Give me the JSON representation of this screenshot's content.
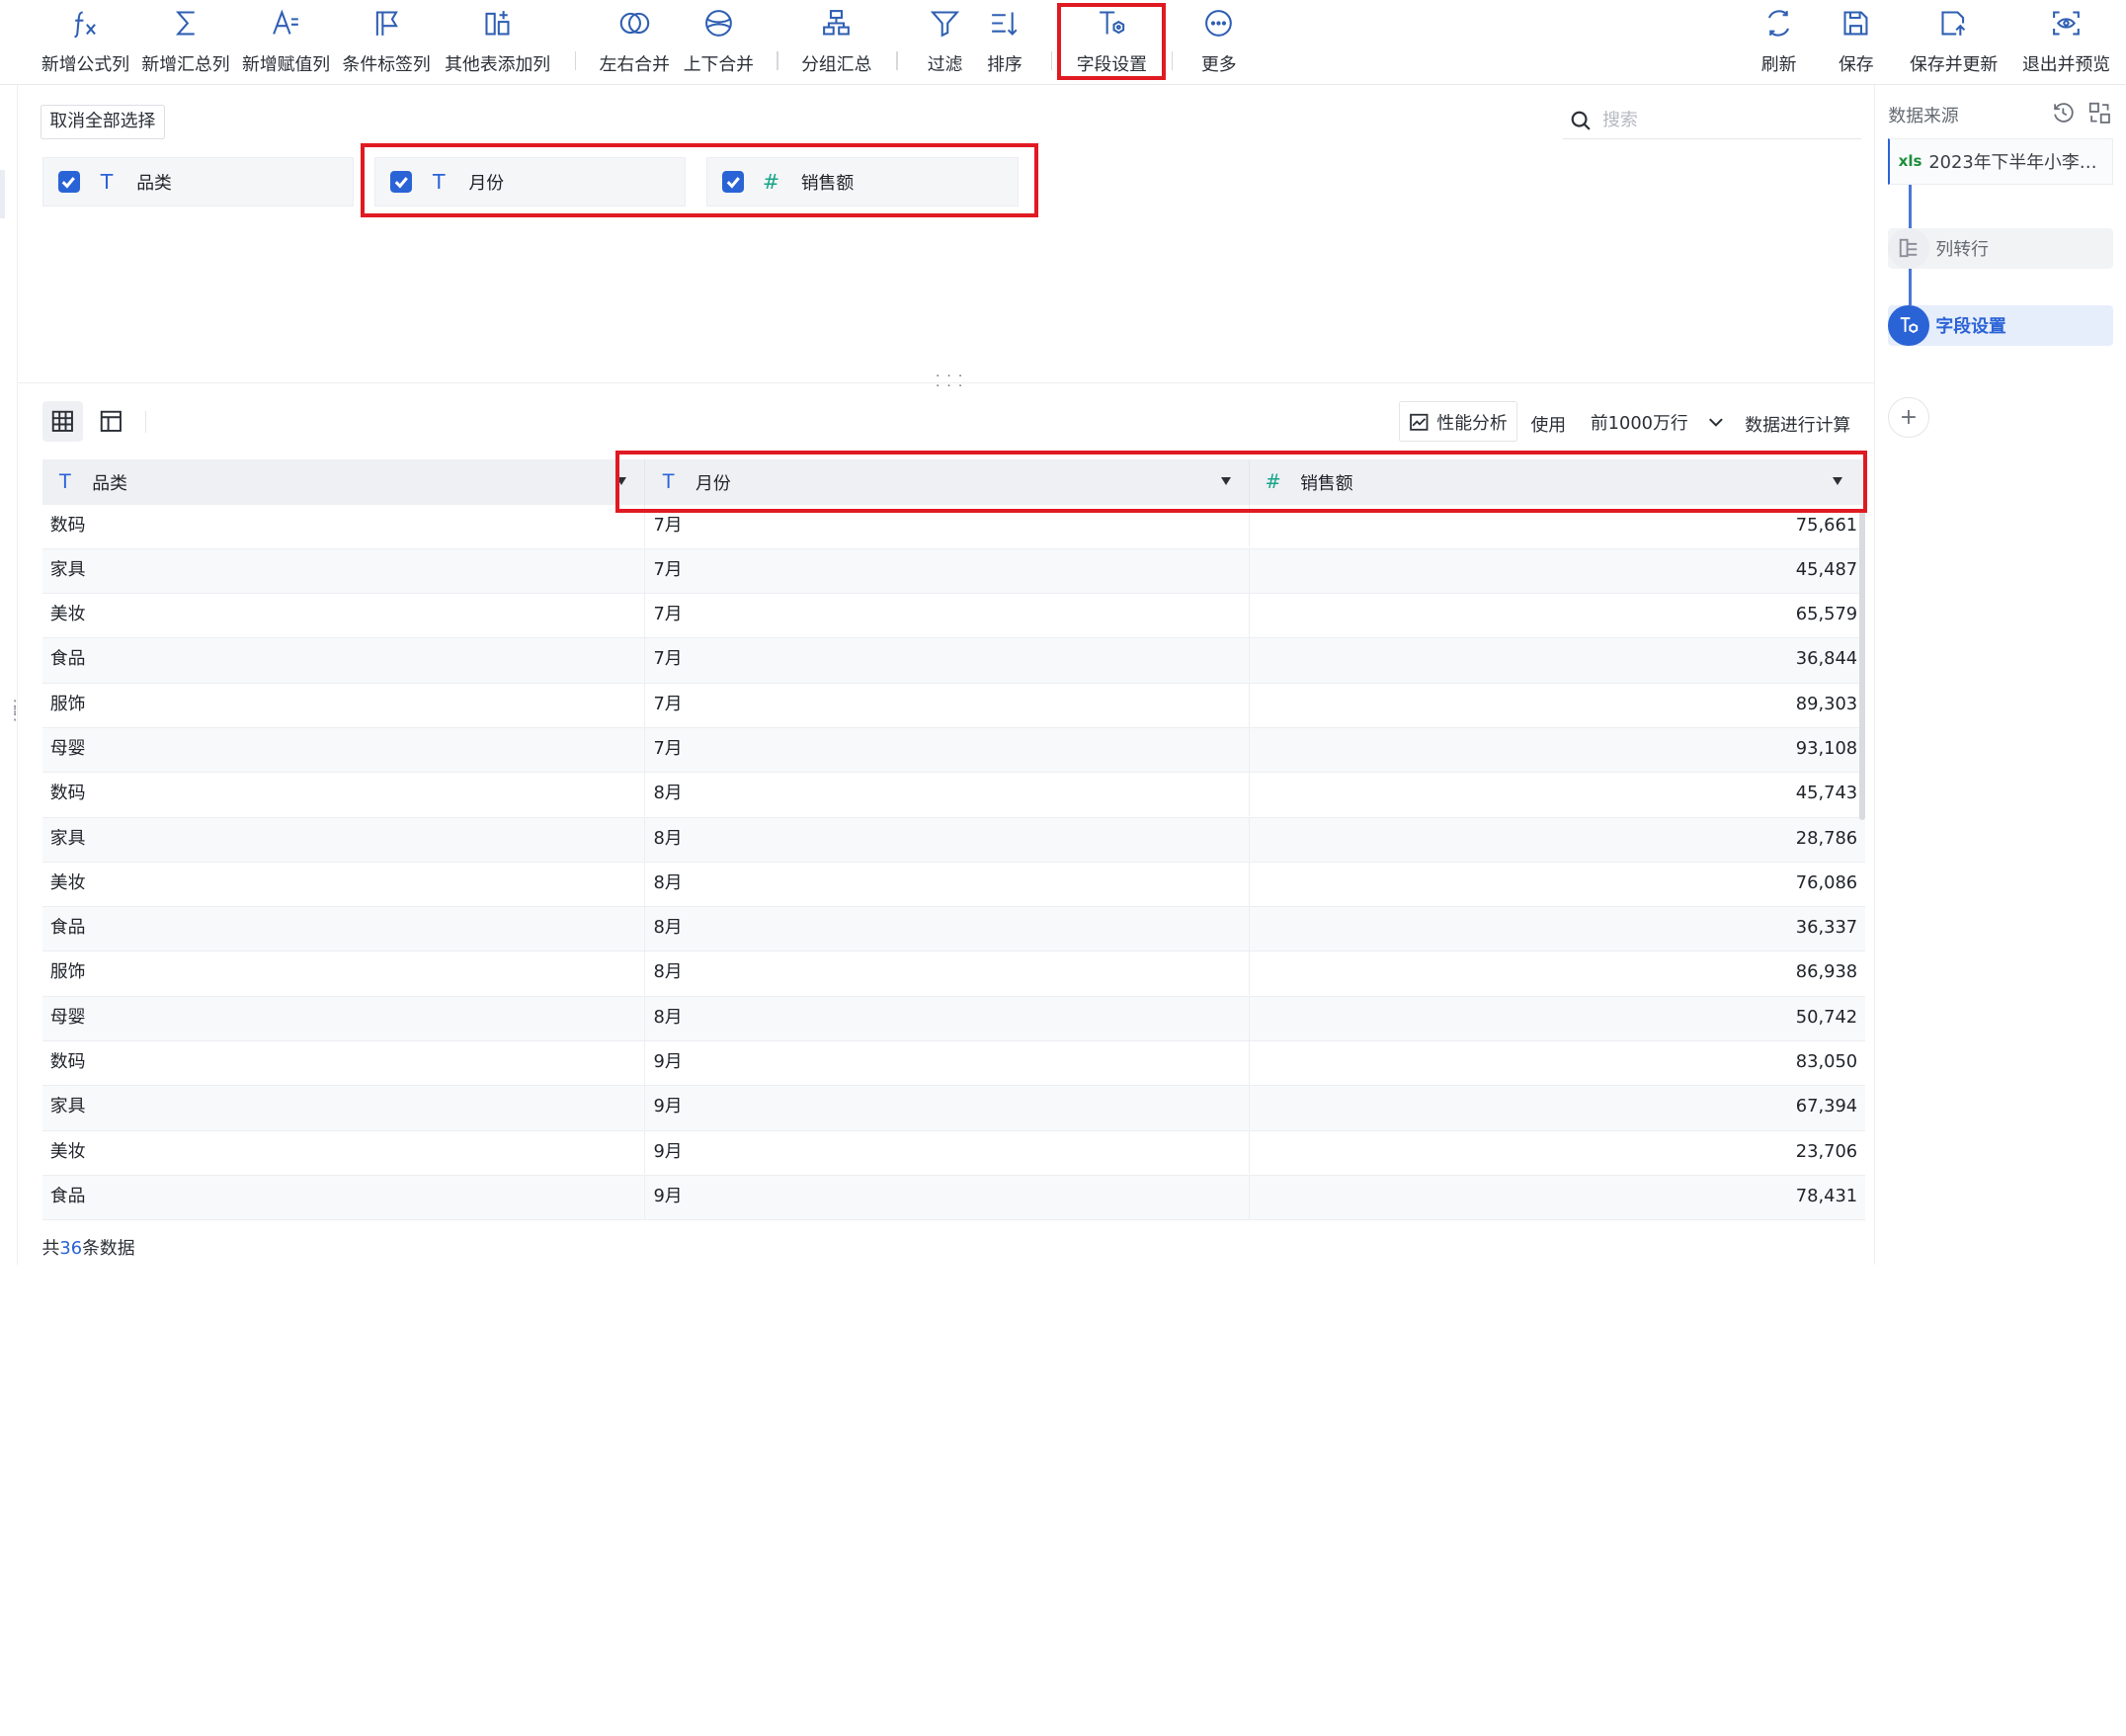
{
  "toolbar": {
    "items": [
      {
        "label": "新增公式列",
        "icon": "formula-icon"
      },
      {
        "label": "新增汇总列",
        "icon": "sigma-icon"
      },
      {
        "label": "新增赋值列",
        "icon": "assign-value-icon"
      },
      {
        "label": "条件标签列",
        "icon": "condition-tag-icon"
      },
      {
        "label": "其他表添加列",
        "icon": "add-column-from-table-icon"
      },
      {
        "label": "左右合并",
        "icon": "join-horizontal-icon"
      },
      {
        "label": "上下合并",
        "icon": "union-vertical-icon"
      },
      {
        "label": "分组汇总",
        "icon": "group-summary-icon"
      },
      {
        "label": "过滤",
        "icon": "filter-icon"
      },
      {
        "label": "排序",
        "icon": "sort-icon"
      },
      {
        "label": "字段设置",
        "icon": "field-settings-icon"
      },
      {
        "label": "更多",
        "icon": "more-icon"
      }
    ],
    "right": [
      {
        "label": "刷新",
        "icon": "refresh-icon"
      },
      {
        "label": "保存",
        "icon": "save-icon"
      },
      {
        "label": "保存并更新",
        "icon": "save-update-icon"
      },
      {
        "label": "退出并预览",
        "icon": "exit-preview-icon"
      }
    ]
  },
  "field_panel": {
    "deselect_all": "取消全部选择",
    "search_placeholder": "搜索",
    "fields": [
      {
        "name": "品类",
        "type_glyph": "T",
        "checked": true
      },
      {
        "name": "月份",
        "type_glyph": "T",
        "checked": true
      },
      {
        "name": "销售额",
        "type_glyph": "#",
        "checked": true
      }
    ]
  },
  "preview": {
    "perf_label": "性能分析",
    "use_label": "使用",
    "rows_option": "前1000万行",
    "calc_label": "数据进行计算",
    "columns": [
      {
        "name": "品类",
        "type_glyph": "T"
      },
      {
        "name": "月份",
        "type_glyph": "T"
      },
      {
        "name": "销售额",
        "type_glyph": "#"
      }
    ],
    "rows": [
      [
        "数码",
        "7月",
        "75,661"
      ],
      [
        "家具",
        "7月",
        "45,487"
      ],
      [
        "美妆",
        "7月",
        "65,579"
      ],
      [
        "食品",
        "7月",
        "36,844"
      ],
      [
        "服饰",
        "7月",
        "89,303"
      ],
      [
        "母婴",
        "7月",
        "93,108"
      ],
      [
        "数码",
        "8月",
        "45,743"
      ],
      [
        "家具",
        "8月",
        "28,786"
      ],
      [
        "美妆",
        "8月",
        "76,086"
      ],
      [
        "食品",
        "8月",
        "36,337"
      ],
      [
        "服饰",
        "8月",
        "86,938"
      ],
      [
        "母婴",
        "8月",
        "50,742"
      ],
      [
        "数码",
        "9月",
        "83,050"
      ],
      [
        "家具",
        "9月",
        "67,394"
      ],
      [
        "美妆",
        "9月",
        "23,706"
      ],
      [
        "食品",
        "9月",
        "78,431"
      ]
    ],
    "footer_prefix": "共",
    "footer_count": "36",
    "footer_suffix": "条数据"
  },
  "side_panel": {
    "title": "数据来源",
    "source_badge": "xls",
    "source_name": "2023年下半年小李直…",
    "steps": [
      {
        "label": "列转行",
        "state": "done"
      },
      {
        "label": "字段设置",
        "state": "active"
      }
    ]
  },
  "colors": {
    "accent": "#2a63d6",
    "highlight_box": "#e01a22",
    "number_type": "#17a589"
  }
}
